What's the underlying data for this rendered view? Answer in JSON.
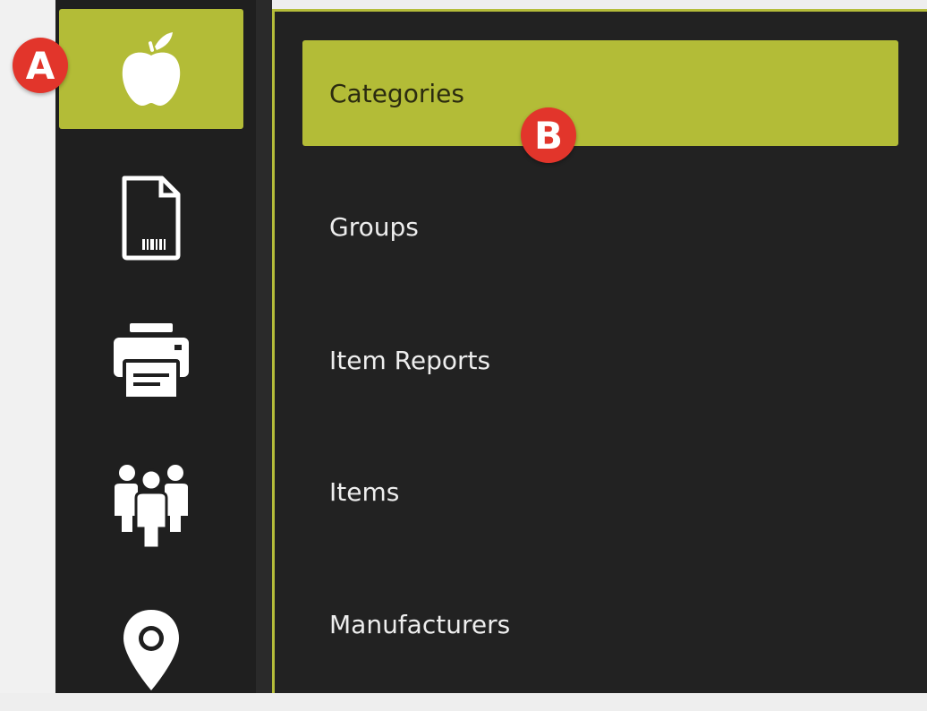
{
  "colors": {
    "accent": "#b3bc37",
    "sidebar_bg": "#1f1f1f",
    "panel_bg": "#222222",
    "badge": "#e2352b"
  },
  "sidebar": {
    "items": [
      {
        "icon": "apple-icon",
        "active": true
      },
      {
        "icon": "barcode-document-icon",
        "active": false
      },
      {
        "icon": "printer-icon",
        "active": false
      },
      {
        "icon": "people-group-icon",
        "active": false
      },
      {
        "icon": "location-pin-icon",
        "active": false
      }
    ]
  },
  "menu": {
    "items": [
      {
        "label": "Categories",
        "active": true
      },
      {
        "label": "Groups",
        "active": false
      },
      {
        "label": "Item Reports",
        "active": false
      },
      {
        "label": "Items",
        "active": false
      },
      {
        "label": "Manufacturers",
        "active": false
      }
    ]
  },
  "annotations": {
    "a": "A",
    "b": "B"
  }
}
